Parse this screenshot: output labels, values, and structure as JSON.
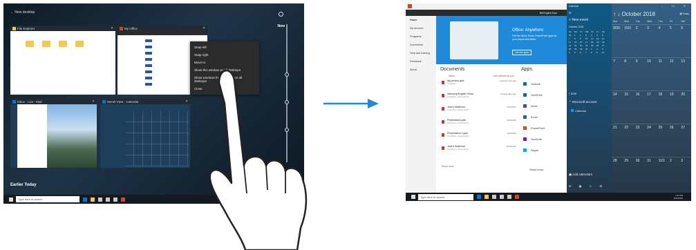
{
  "left": {
    "task_view_title": "← New desktop",
    "timeline_label": "Now",
    "earlier_label": "Earlier Today",
    "taskbar_search": "Type here to search",
    "windows": [
      {
        "title": "File Explorer"
      },
      {
        "title": "My Office"
      },
      {
        "title": "Inbox - Live - Mail"
      },
      {
        "title": "Month View - Calendar"
      }
    ],
    "context_menu": [
      "Snap left",
      "Snap right",
      "Move to",
      "Show this window on all desktops",
      "Show windows from this app on all desktops",
      "Close"
    ]
  },
  "right": {
    "office": {
      "user": "Bill English  Sam",
      "nav": [
        "Home",
        "My account",
        "Programs",
        "Documents",
        "Help and training",
        "Feedback",
        "About"
      ],
      "banner_title": "Office: Anywhere",
      "banner_text": "Get the Word, Excel, PowerPoint apps for your phone and tablet.",
      "banner_button": "Get the apps",
      "documents_heading": "Documents",
      "doc_col_name": "Name",
      "doc_col_opened": "Last opened by you",
      "docs": [
        {
          "name": "sky photos.pptx",
          "loc": "OneDrive",
          "date": "several hours ago"
        },
        {
          "name": "Samsung English Group",
          "loc": "OneDrive » Documents",
          "date": "several days ago"
        },
        {
          "name": "Jane's Notebook",
          "loc": "OneDrive » Documents",
          "date": "3/16/2017"
        },
        {
          "name": "Presentation.pptx",
          "loc": "OneDrive » Documents",
          "date": "9/30/2016"
        },
        {
          "name": "Presentation 1.pptx",
          "loc": "OneDrive » Documents",
          "date": "9/30/2016"
        },
        {
          "name": "Jane's Notebook",
          "loc": "OneDrive » Documents",
          "date": "11/30/2016"
        }
      ],
      "show_more": "Show more",
      "apps_heading": "Apps",
      "apps": [
        {
          "name": "Outlook",
          "color": "#0f6cbd"
        },
        {
          "name": "OneDrive",
          "color": "#0a64c9"
        },
        {
          "name": "Word",
          "color": "#2b579a"
        },
        {
          "name": "Excel",
          "color": "#217346"
        },
        {
          "name": "PowerPoint",
          "color": "#d24726"
        },
        {
          "name": "OneNote",
          "color": "#7719aa"
        },
        {
          "name": "Skype",
          "color": "#00aff0"
        }
      ],
      "apps_more": "Show more"
    },
    "calendar": {
      "title": "Calendar",
      "new_event": "New event",
      "mini_month": "October 2018",
      "mini_days": [
        "Su",
        "Mo",
        "Tu",
        "We",
        "Th",
        "Fr",
        "Sa"
      ],
      "mini_rows": [
        [
          "30",
          "1",
          "2",
          "3",
          "4",
          "5",
          "6"
        ],
        [
          "7",
          "8",
          "9",
          "10",
          "11",
          "12",
          "13"
        ],
        [
          "14",
          "15",
          "16",
          "17",
          "18",
          "19",
          "20"
        ],
        [
          "21",
          "22",
          "23",
          "24",
          "25",
          "26",
          "27"
        ],
        [
          "28",
          "29",
          "30",
          "31",
          "1",
          "2",
          "3"
        ],
        [
          "4",
          "5",
          "6",
          "7",
          "8",
          "9",
          "10"
        ]
      ],
      "live": "Live",
      "ms_account": "Microsoft account",
      "calendar_item": "Calendar",
      "add_calendars": "Add calendars",
      "month_header": "October 2018",
      "today": "Today",
      "weekdays": [
        "Sun",
        "Mon",
        "Tue",
        "Wed",
        "Thu",
        "Fri",
        "Sat"
      ],
      "weeks": [
        [
          "9/30",
          "10/1",
          "2",
          "3",
          "4",
          "5",
          "6"
        ],
        [
          "7",
          "8",
          "9",
          "10",
          "11",
          "12",
          "13"
        ],
        [
          "14",
          "15",
          "16",
          "17",
          "18",
          "19",
          "20"
        ],
        [
          "21",
          "22",
          "23",
          "24",
          "25",
          "26",
          "27"
        ],
        [
          "28",
          "29",
          "30",
          "31",
          "11/1",
          "2",
          "3"
        ]
      ],
      "clock": "4:11 PM",
      "date": "10/4/2018"
    },
    "taskbar_search": "Type here to search"
  }
}
